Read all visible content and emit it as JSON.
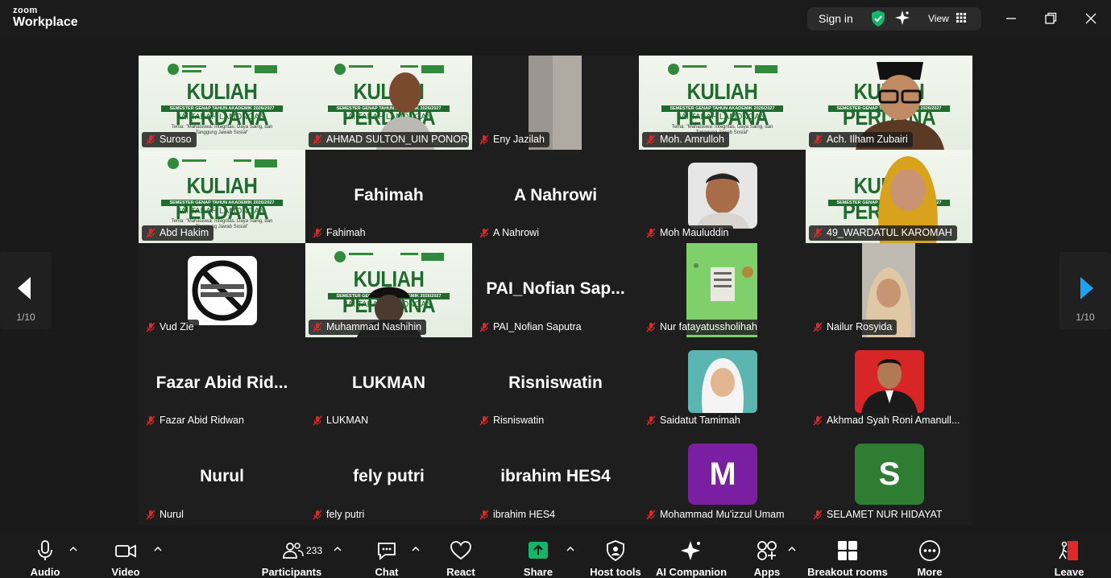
{
  "app": {
    "brand_top": "zoom",
    "brand_bottom": "Workplace"
  },
  "titlebar": {
    "sign_in": "Sign in",
    "view": "View"
  },
  "banner": {
    "title": "KULIAH PERDANA",
    "sub": "SEMESTER GENAP TAHUN AKADEMIK 2026/2027",
    "inst": "IAI TABAH LAMONGAN",
    "small": "Tema: \"Mahasiswa: Integritas, Daya Saing, dan Tanggung Jawab Sosial\""
  },
  "tiles": [
    {
      "label": "Suroso"
    },
    {
      "label": "AHMAD SULTON_UIN PONORO..."
    },
    {
      "label": "Eny Jazilah"
    },
    {
      "label": "Moh. Amrulloh"
    },
    {
      "label": "Ach. Ilham Zubairi"
    },
    {
      "label": "Abd Hakim"
    },
    {
      "label": "Fahimah",
      "big": "Fahimah"
    },
    {
      "label": "A Nahrowi",
      "big": "A Nahrowi"
    },
    {
      "label": "Moh Mauluddin"
    },
    {
      "label": "49_WARDATUL KAROMAH"
    },
    {
      "label": "Vud Zie"
    },
    {
      "label": "Muhammad Nashihin"
    },
    {
      "label": "PAI_Nofian Saputra",
      "big": "PAI_Nofian  Sap..."
    },
    {
      "label": "Nur fatayatussholihah"
    },
    {
      "label": "Nailur Rosyida"
    },
    {
      "label": "Fazar Abid Ridwan",
      "big": "Fazar  Abid  Rid..."
    },
    {
      "label": "LUKMAN",
      "big": "LUKMAN"
    },
    {
      "label": "Risniswatin",
      "big": "Risniswatin"
    },
    {
      "label": "Saidatut Tamimah"
    },
    {
      "label": "Akhmad Syah Roni Amanull..."
    },
    {
      "label": "Nurul",
      "big": "Nurul"
    },
    {
      "label": "fely putri",
      "big": "fely putri"
    },
    {
      "label": "ibrahim HES4",
      "big": "ibrahim HES4"
    },
    {
      "label": "Mohammad Mu'izzul Umam",
      "avatar": "M"
    },
    {
      "label": "SELAMET NUR HIDAYAT",
      "avatar": "S"
    }
  ],
  "pager": {
    "left": "1/10",
    "right": "1/10"
  },
  "toolbar": {
    "audio": "Audio",
    "video": "Video",
    "participants": "Participants",
    "participants_count": "233",
    "chat": "Chat",
    "react": "React",
    "share": "Share",
    "host_tools": "Host tools",
    "ai_companion": "AI Companion",
    "apps": "Apps",
    "breakout_rooms": "Breakout rooms",
    "more": "More",
    "leave": "Leave"
  },
  "colors": {
    "share_green": "#12b76a",
    "active_outline": "#3fe08a",
    "muted_red": "#e02828",
    "avatar_m": "#7b1fa2",
    "avatar_s": "#2e7d32"
  }
}
